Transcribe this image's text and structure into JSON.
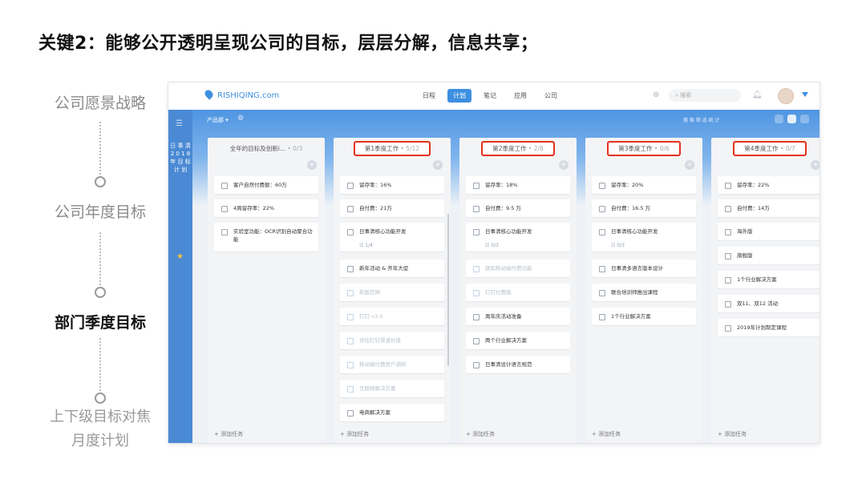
{
  "slide": {
    "title": "关键2：能够公开透明呈现公司的目标，层层分解，信息共享；"
  },
  "steps": [
    {
      "label": "公司愿景战略"
    },
    {
      "label": "公司年度目标"
    },
    {
      "label": "部门季度目标"
    },
    {
      "label_line1": "上下级目标对焦",
      "label_line2": "月度计划"
    }
  ],
  "app": {
    "logo_text": "RISHIQING.com",
    "nav_tabs": [
      "日程",
      "计划",
      "笔记",
      "应用",
      "公司"
    ],
    "active_tab": "计划",
    "search_placeholder": "搜索",
    "project_selector": "产品部 ▾",
    "toolbar_right": "搜 索   筛 选   统 计",
    "sidebar_text": "日 事 清 2 0 1 8 年 目 标 计 划",
    "add_task_label": "+ 添加任务",
    "columns": [
      {
        "title": "全年的目标及创新i...",
        "count": "• 0/3",
        "cards": [
          {
            "text": "客户自然付费额：60万"
          },
          {
            "text": "4周留存率：22%"
          },
          {
            "text": "实验室功能：OCR识别自动聚合功能"
          }
        ]
      },
      {
        "title": "第1季度工作",
        "count": "• 5/12",
        "cards": [
          {
            "text": "留存率：16%"
          },
          {
            "text": "自付费：21万"
          },
          {
            "text": "日事清核心功能开发",
            "sub": "☷ 1/4"
          },
          {
            "text": "新年活动 & 开年大促"
          },
          {
            "text": "新版官网",
            "done": true
          },
          {
            "text": "钉钉-v3.0",
            "done": true
          },
          {
            "text": "评估钉钉渠道价值",
            "done": true
          },
          {
            "text": "移动端付费用户调研",
            "done": true
          },
          {
            "text": "互联网解决方案",
            "done": true
          },
          {
            "text": "电商解决方案"
          }
        ]
      },
      {
        "title": "第2季度工作",
        "count": "• 2/8",
        "cards": [
          {
            "text": "留存率：18%"
          },
          {
            "text": "自付费：9.5 万"
          },
          {
            "text": "日事清核心功能开发",
            "sub": "☷ 0/3"
          },
          {
            "text": "跟踪移动端付费功能",
            "done": true
          },
          {
            "text": "钉钉付费版",
            "done": true
          },
          {
            "text": "周年庆活动准备"
          },
          {
            "text": "两个行业解决方案"
          },
          {
            "text": "日事清设计语言规范"
          }
        ]
      },
      {
        "title": "第3季度工作",
        "count": "• 0/6",
        "cards": [
          {
            "text": "留存率：20%"
          },
          {
            "text": "自付费：16.5 万"
          },
          {
            "text": "日事清核心功能开发",
            "sub": "☷ 0/3"
          },
          {
            "text": "日事清多语言版本设计"
          },
          {
            "text": "联合培训师推出课程"
          },
          {
            "text": "1个行业解决方案"
          }
        ]
      },
      {
        "title": "第4季度工作",
        "count": "• 0/7",
        "cards": [
          {
            "text": "留存率：22%"
          },
          {
            "text": "自付费：14万"
          },
          {
            "text": "海外版"
          },
          {
            "text": "旗舰版"
          },
          {
            "text": "1个行业解决方案"
          },
          {
            "text": "双11、双12 活动"
          },
          {
            "text": "2019年计划制定课程"
          }
        ]
      }
    ]
  },
  "colors": {
    "accent": "#3d8fe0",
    "sidebar": "#4a89d4",
    "highlight_box": "#e5321c"
  }
}
